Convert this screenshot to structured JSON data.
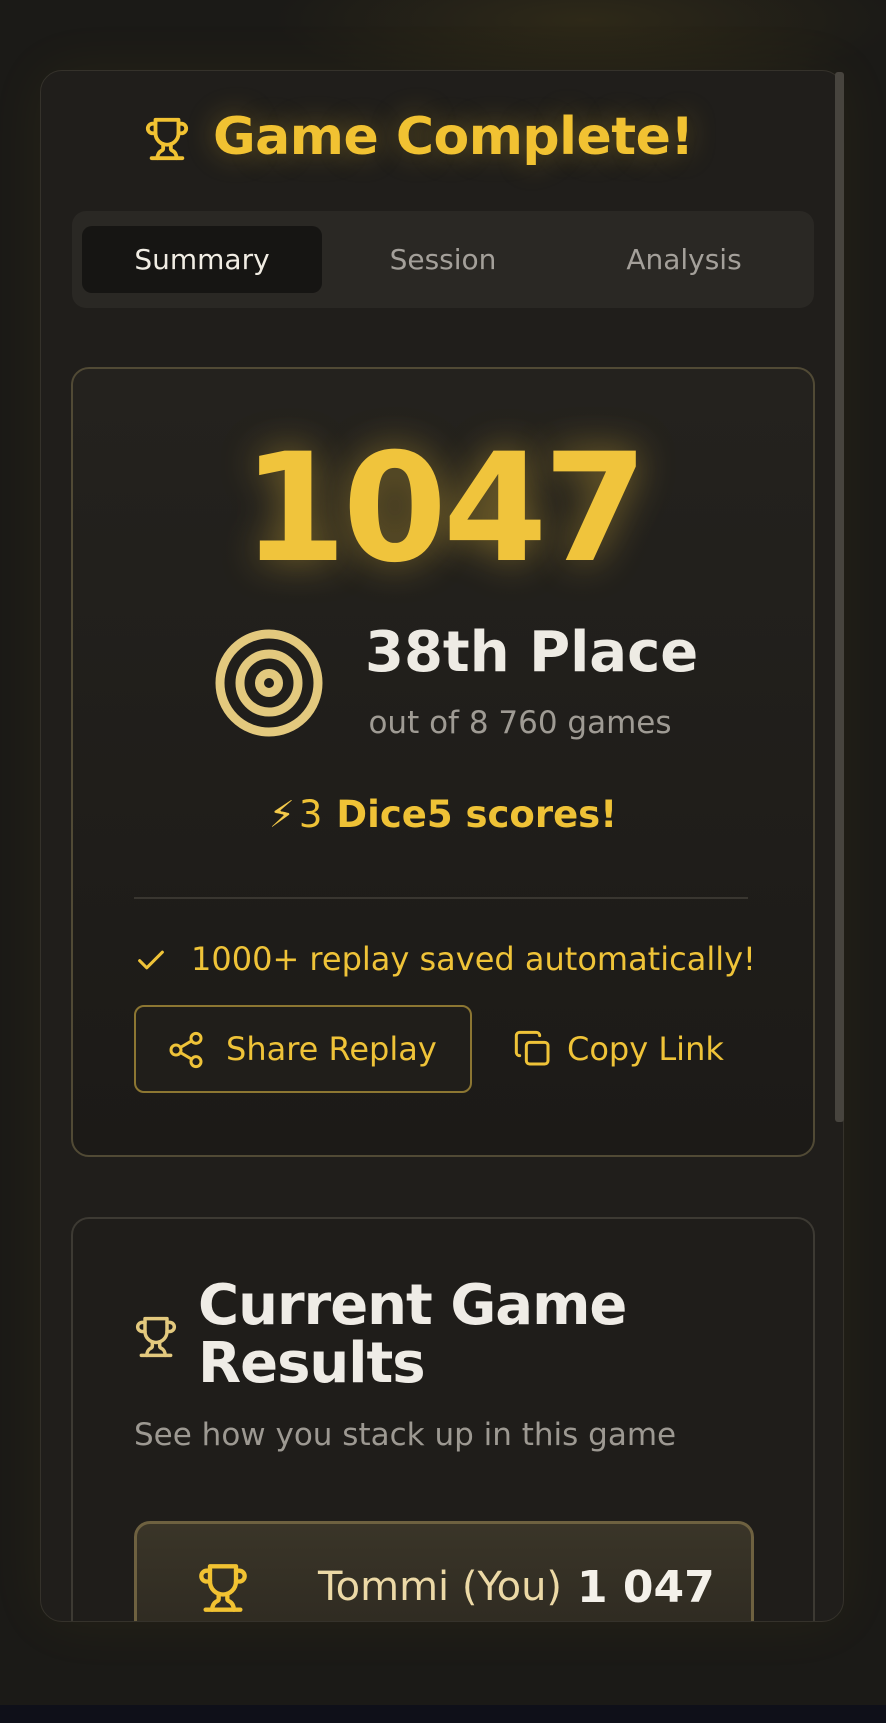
{
  "header": {
    "title": "Game Complete!",
    "icon": "trophy-icon",
    "accent_color": "#f1c232"
  },
  "tabs": [
    {
      "label": "Summary",
      "active": true
    },
    {
      "label": "Session",
      "active": false
    },
    {
      "label": "Analysis",
      "active": false
    }
  ],
  "score_card": {
    "score": "1047",
    "place": "38th Place",
    "place_sub": "out of 8 760 games",
    "dice_bolt": "⚡",
    "dice_count": "3",
    "dice_label": "Dice5 scores!",
    "saved_text": "1000+ replay saved automatically!",
    "share_label": "Share Replay",
    "copy_label": "Copy Link"
  },
  "results": {
    "title": "Current Game Results",
    "subtitle": "See how you stack up in this game",
    "rows": [
      {
        "name": "Tommi (You)",
        "score": "1 047"
      }
    ]
  }
}
